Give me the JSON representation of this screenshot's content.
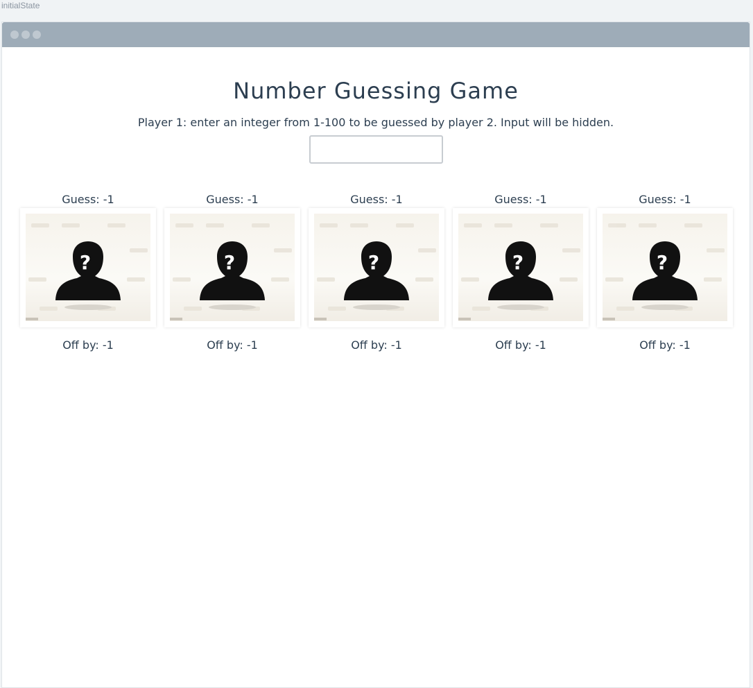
{
  "state_label": "initialState",
  "title": "Number Guessing Game",
  "prompt": "Player 1: enter an integer from 1-100 to be guessed by player 2. Input will be hidden.",
  "secret_input": {
    "value": "",
    "placeholder": ""
  },
  "players": [
    {
      "guess": "Guess: -1",
      "off_by": "Off by: -1",
      "image_icon": "unknown-person-icon"
    },
    {
      "guess": "Guess: -1",
      "off_by": "Off by: -1",
      "image_icon": "unknown-person-icon"
    },
    {
      "guess": "Guess: -1",
      "off_by": "Off by: -1",
      "image_icon": "unknown-person-icon"
    },
    {
      "guess": "Guess: -1",
      "off_by": "Off by: -1",
      "image_icon": "unknown-person-icon"
    },
    {
      "guess": "Guess: -1",
      "off_by": "Off by: -1",
      "image_icon": "unknown-person-icon"
    }
  ],
  "colors": {
    "titlebar": "#9eacb8",
    "text": "#2c3e50",
    "background": "#f0f3f5"
  }
}
